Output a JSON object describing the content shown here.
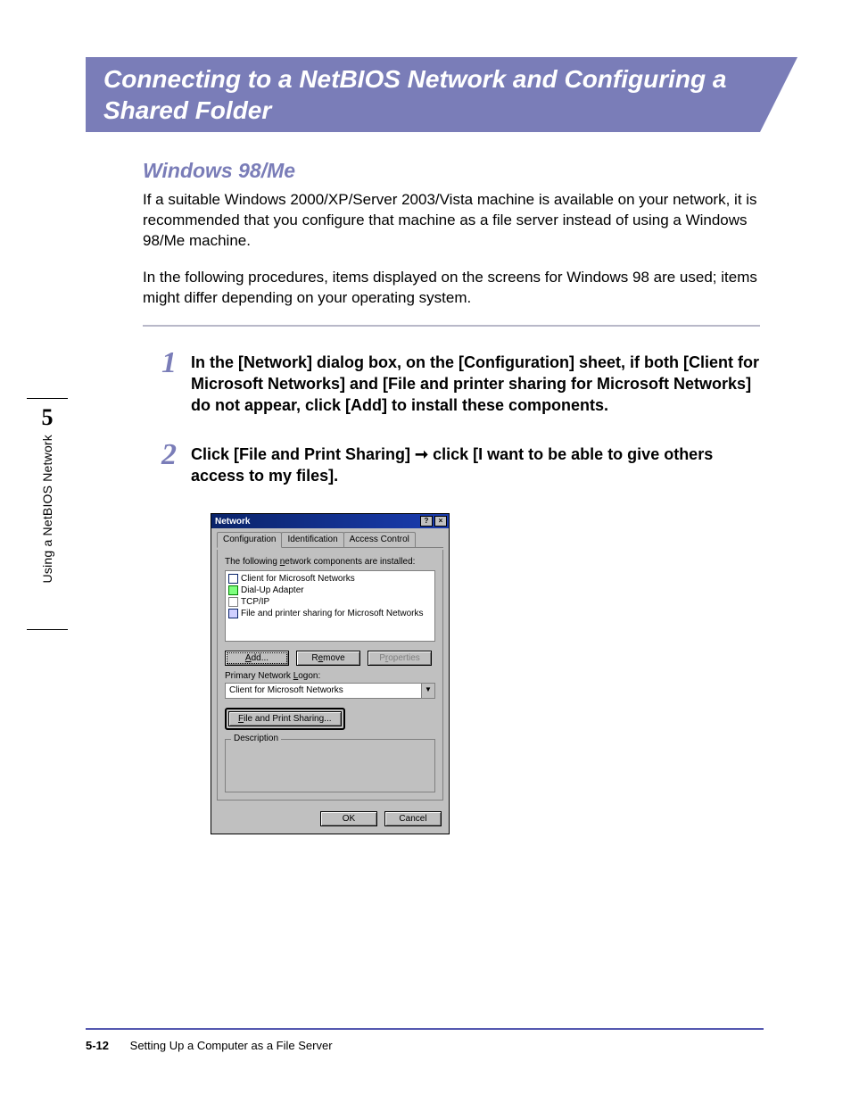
{
  "banner": {
    "title": "Connecting to a NetBIOS Network and Configuring a Shared Folder"
  },
  "sideTab": {
    "chapter": "5",
    "label": "Using a NetBIOS Network"
  },
  "subheading": "Windows 98/Me",
  "intro1": "If a suitable Windows 2000/XP/Server 2003/Vista machine is available on your network, it is recommended that you configure that machine as a file server instead of using a Windows 98/Me machine.",
  "intro2": "In the following procedures, items displayed on the screens for Windows 98 are used; items might differ depending on your operating system.",
  "steps": {
    "1": {
      "num": "1",
      "text": "In the [Network] dialog box, on the [Configuration] sheet, if both [Client for Microsoft Networks] and [File and printer sharing for Microsoft Networks] do not appear, click [Add] to install these components."
    },
    "2": {
      "num": "2",
      "text_a": "Click [File and Print Sharing] ",
      "arrow": "➞",
      "text_b": " click [I want to be able to give others access to my files]."
    }
  },
  "dialog": {
    "title": "Network",
    "helpGlyph": "?",
    "closeGlyph": "×",
    "tabs": {
      "configuration": "Configuration",
      "identification": "Identification",
      "access": "Access Control"
    },
    "componentsLabel": "The following network components are installed:",
    "components": [
      "Client for Microsoft Networks",
      "Dial-Up Adapter",
      "TCP/IP",
      "File and printer sharing for Microsoft Networks"
    ],
    "buttons": {
      "add": "Add...",
      "remove": "Remove",
      "properties": "Properties"
    },
    "primaryLabel": "Primary Network Logon:",
    "primaryValue": "Client for Microsoft Networks",
    "filePrintSharing": "File and Print Sharing...",
    "descriptionLegend": "Description",
    "ok": "OK",
    "cancel": "Cancel"
  },
  "footer": {
    "pageNumber": "5-12",
    "sectionTitle": "Setting Up a Computer as a File Server"
  }
}
